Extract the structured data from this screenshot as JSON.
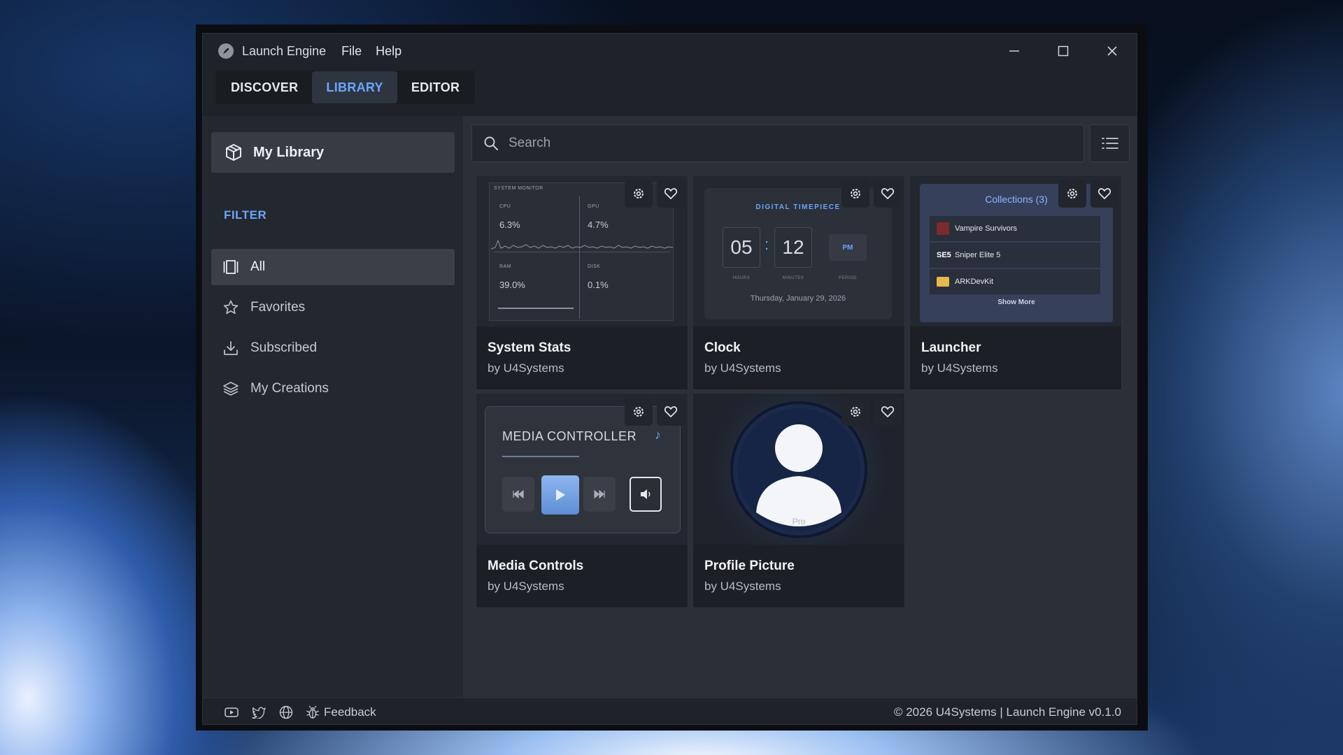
{
  "app": {
    "title": "Launch Engine",
    "menu": [
      "File",
      "Help"
    ]
  },
  "tabs": [
    {
      "label": "DISCOVER",
      "active": false
    },
    {
      "label": "LIBRARY",
      "active": true
    },
    {
      "label": "EDITOR",
      "active": false
    }
  ],
  "sidebar": {
    "library_label": "My Library",
    "filter_heading": "FILTER",
    "filters": [
      {
        "label": "All",
        "icon": "all-icon",
        "active": true
      },
      {
        "label": "Favorites",
        "icon": "star-icon",
        "active": false
      },
      {
        "label": "Subscribed",
        "icon": "download-icon",
        "active": false
      },
      {
        "label": "My Creations",
        "icon": "layers-icon",
        "active": false
      }
    ]
  },
  "search": {
    "placeholder": "Search",
    "value": ""
  },
  "cards": [
    {
      "name": "System Stats",
      "author": "by U4Systems"
    },
    {
      "name": "Clock",
      "author": "by U4Systems"
    },
    {
      "name": "Launcher",
      "author": "by U4Systems"
    },
    {
      "name": "Media Controls",
      "author": "by U4Systems"
    },
    {
      "name": "Profile Picture",
      "author": "by U4Systems"
    }
  ],
  "previews": {
    "system": {
      "title": "SYSTEM MONITOR",
      "cpu_label": "CPU",
      "cpu": "6.3%",
      "gpu_label": "GPU",
      "gpu": "4.7%",
      "ram_label": "RAM",
      "ram": "39.0%",
      "disk_label": "DISK",
      "disk": "0.1%"
    },
    "clock": {
      "title": "DIGITAL TIMEPIECE",
      "hours": "05",
      "minutes": "12",
      "period": "PM",
      "hours_label": "HOURS",
      "minutes_label": "MINUTES",
      "period_label": "PERIOD",
      "date": "Thursday, January 29, 2026"
    },
    "launcher": {
      "title": "Collections (3)",
      "items": [
        "Vampire Survivors",
        "Sniper Elite 5",
        "ARKDevKit"
      ],
      "sniper_logo": "SE5",
      "show_more": "Show More"
    },
    "media": {
      "title": "MEDIA CONTROLLER"
    },
    "profile": {
      "badge": "Pro"
    }
  },
  "footer": {
    "feedback": "Feedback",
    "copyright": "© 2026 U4Systems | Launch Engine v0.1.0"
  },
  "colors": {
    "accent": "#6aa6ff",
    "window_bg": "#1f2228",
    "panel_bg": "#2b2f37"
  }
}
